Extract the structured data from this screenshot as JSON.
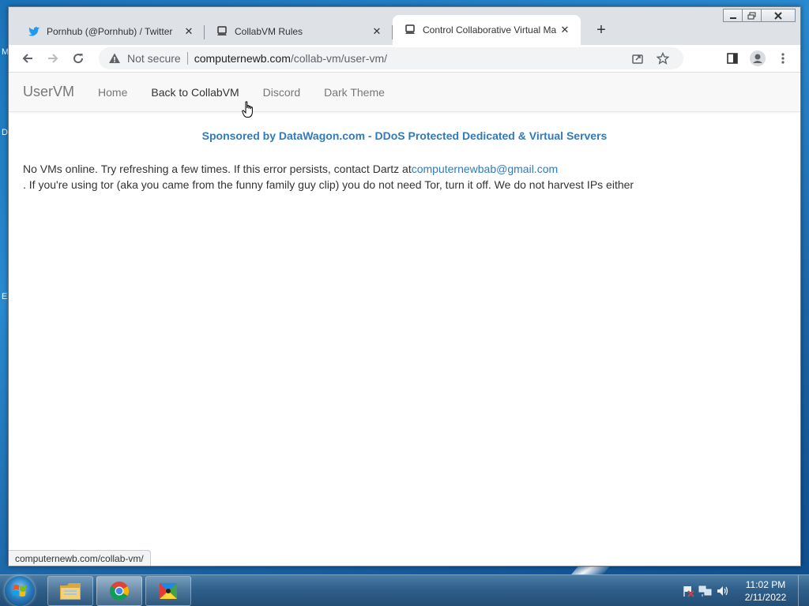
{
  "browser": {
    "tabs": [
      {
        "title": "Pornhub (@Pornhub) / Twitter",
        "favicon": "twitter-bird-icon"
      },
      {
        "title": "CollabVM Rules",
        "favicon": "collabvm-icon"
      },
      {
        "title": "Control Collaborative Virtual Ma",
        "favicon": "collabvm-icon",
        "active": true
      }
    ],
    "security_label": "Not secure",
    "url_host": "computernewb.com",
    "url_path": "/collab-vm/user-vm/",
    "status_url": "computernewb.com/collab-vm/"
  },
  "site": {
    "brand": "UserVM",
    "nav": [
      "Home",
      "Back to CollabVM",
      "Discord",
      "Dark Theme"
    ],
    "sponsor": "Sponsored by DataWagon.com - DDoS Protected Dedicated & Virtual Servers",
    "message_start": "No VMs online. Try refreshing a few times. If this error persists, contact Dartz at",
    "email": "computernewbab@gmail.com",
    "message_end": ". If you're using tor (aka you came from the funny family guy clip) you do not need Tor, turn it off. We do not harvest IPs either"
  },
  "taskbar": {
    "time": "11:02 PM",
    "date": "2/11/2022"
  },
  "desktop": {
    "icon_letters": [
      "M",
      "D",
      "E"
    ]
  },
  "colors": {
    "link": "#337ab7",
    "brand": "#777777"
  }
}
